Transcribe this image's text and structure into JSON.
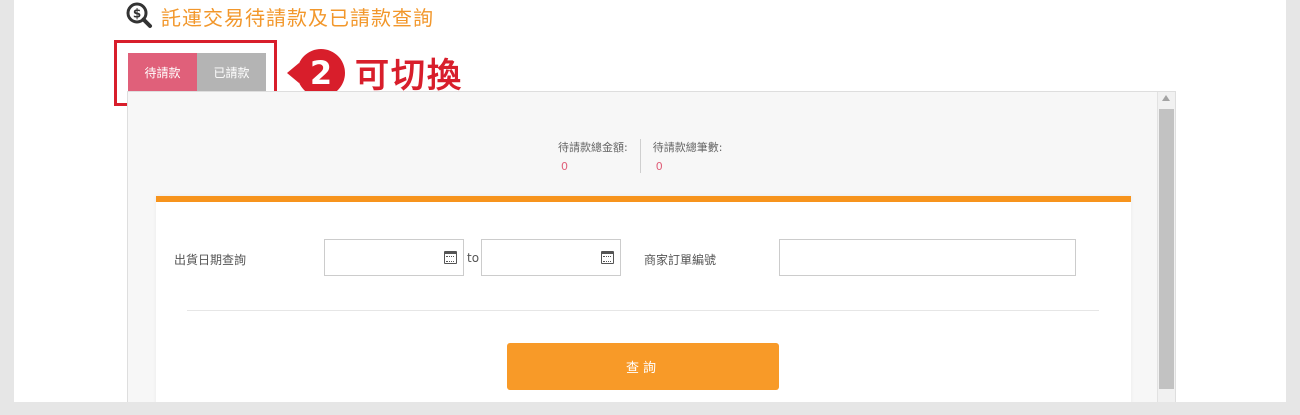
{
  "header": {
    "title": "託運交易待請款及已請款查詢",
    "icon": "search-dollar-icon"
  },
  "tabs": [
    {
      "label": "待請款",
      "active": true
    },
    {
      "label": "已請款",
      "active": false
    }
  ],
  "callout": {
    "number": "2",
    "text": "可切換"
  },
  "summary": {
    "total_amount_label": "待請款總金額:",
    "total_amount_value": "0",
    "total_count_label": "待請款總筆數:",
    "total_count_value": "0"
  },
  "form": {
    "ship_date_label": "出貨日期查詢",
    "date_from_value": "",
    "date_to_value": "",
    "to_label": "to",
    "order_no_label": "商家訂單編號",
    "order_no_value": "",
    "query_button": "查詢"
  },
  "colors": {
    "accent": "#f89a28",
    "title": "#f2972b",
    "active_tab": "#e0607a",
    "inactive_tab": "#b4b4b4",
    "annotation": "#d81e2b"
  }
}
